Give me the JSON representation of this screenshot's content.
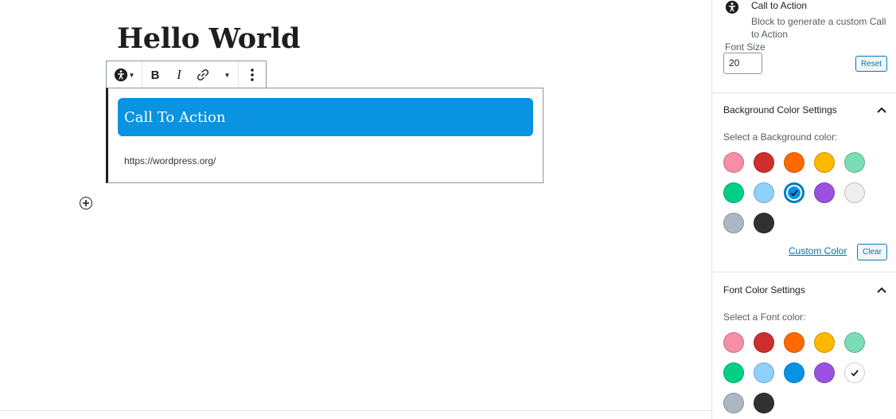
{
  "editor": {
    "title": "Hello World",
    "cta_text": "Call To Action",
    "cta_url": "https://wordpress.org/",
    "cta_background": "#0993e1"
  },
  "toolbar": {
    "block_icon": "accessibility-icon",
    "bold_label": "B",
    "italic_label": "I",
    "link_icon": "link-icon",
    "more_rich_text_icon": "chevron-down-icon",
    "more_options_icon": "more-vertical-icon"
  },
  "sidebar": {
    "block_card": {
      "title": "Call to Action",
      "description": "Block to generate a custom Call to Action"
    },
    "font_size": {
      "label": "Font Size",
      "value": "20",
      "reset_label": "Reset"
    },
    "background_panel": {
      "title": "Background Color Settings",
      "subtitle": "Select a Background color:",
      "custom_label": "Custom Color",
      "clear_label": "Clear",
      "swatches": [
        "#f78da7",
        "#cf2e2e",
        "#ff6900",
        "#fcb900",
        "#7bdcb5",
        "#00d084",
        "#8ed1fc",
        "#0693e3",
        "#9b51e0",
        "#eeeeee",
        "#abb8c3",
        "#313131"
      ],
      "selected_index": 7
    },
    "font_panel": {
      "title": "Font Color Settings",
      "subtitle": "Select a Font color:",
      "swatches": [
        "#f78da7",
        "#cf2e2e",
        "#ff6900",
        "#fcb900",
        "#7bdcb5",
        "#00d084",
        "#8ed1fc",
        "#0693e3",
        "#9b51e0",
        "#ffffff",
        "#abb8c3",
        "#313131"
      ],
      "selected_index": 9
    }
  }
}
